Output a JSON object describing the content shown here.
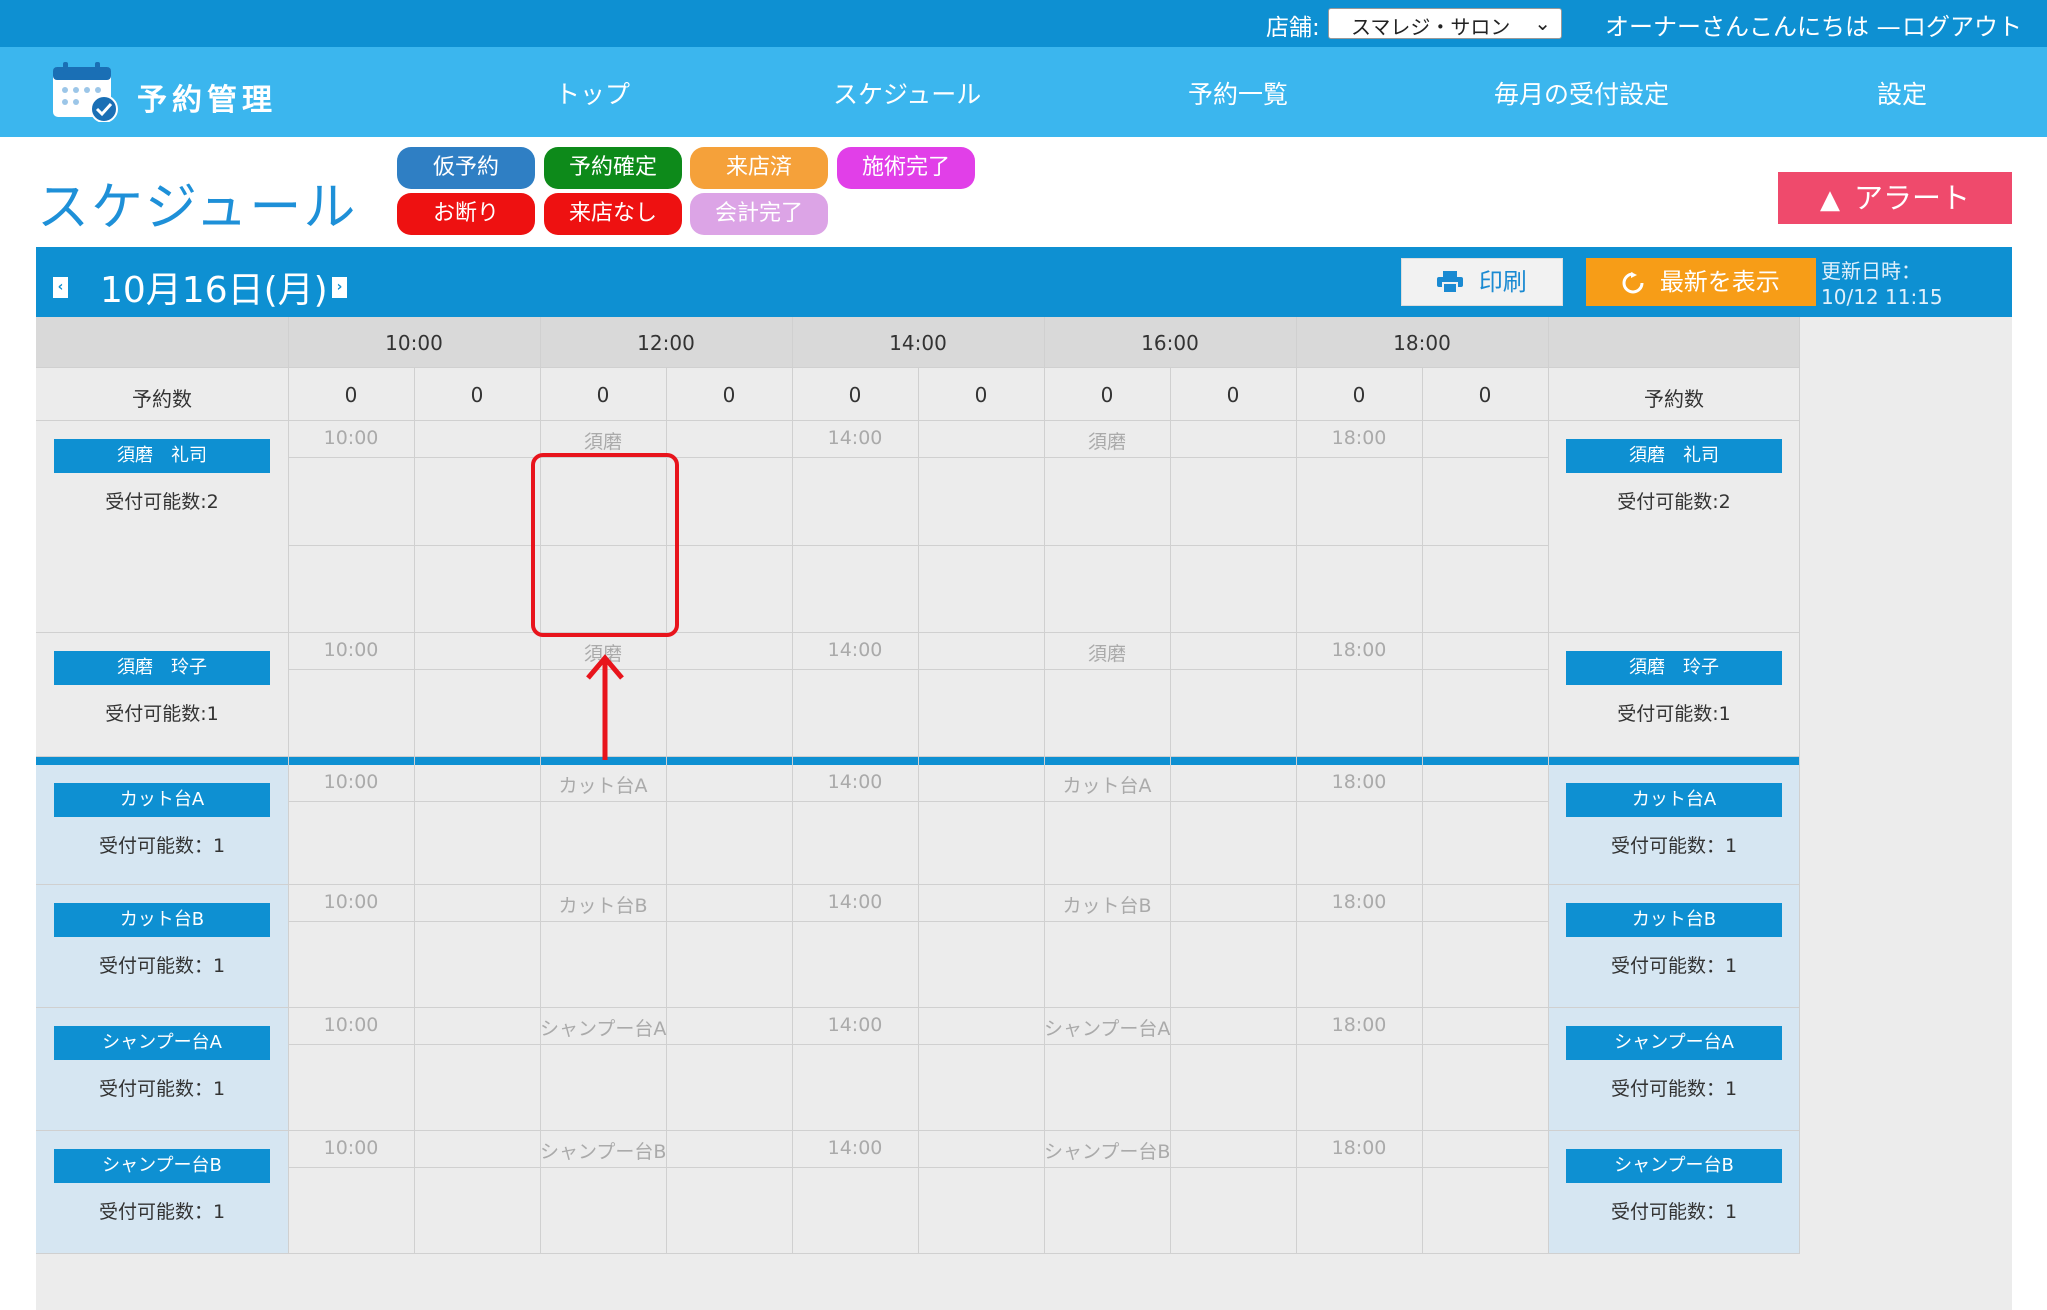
{
  "topbar": {
    "store_label": "店舗:",
    "store_value": "スマレジ・サロン",
    "greeting": "オーナーさんこんにちは —",
    "logout": "ログアウト"
  },
  "nav": {
    "brand": "予約管理",
    "items": [
      "トップ",
      "スケジュール",
      "予約一覧",
      "毎月の受付設定",
      "設定"
    ]
  },
  "page": {
    "title": "スケジュール",
    "alert": "アラート"
  },
  "legend": [
    {
      "label": "仮予約",
      "color": "#2f7fc4"
    },
    {
      "label": "予約確定",
      "color": "#0d8a1a"
    },
    {
      "label": "来店済",
      "color": "#f5a13a"
    },
    {
      "label": "施術完了",
      "color": "#e13fe8"
    },
    {
      "label": "お断り",
      "color": "#ee1111"
    },
    {
      "label": "来店なし",
      "color": "#ee1111"
    },
    {
      "label": "会計完了",
      "color": "#dca4e6"
    }
  ],
  "datebar": {
    "prev": "‹",
    "next": "›",
    "date": "10月16日(月)",
    "print": "印刷",
    "refresh": "最新を表示",
    "updated_label": "更新日時：",
    "updated_value": "10/12 11:15"
  },
  "schedule": {
    "hours": [
      "10:00",
      "12:00",
      "14:00",
      "16:00",
      "18:00"
    ],
    "count_label": "予約数",
    "counts": [
      "0",
      "0",
      "0",
      "0",
      "0",
      "0",
      "0",
      "0",
      "0",
      "0"
    ],
    "staff": [
      {
        "name": "須磨　礼司",
        "capacity": "受付可能数:2",
        "slots": [
          "10:00",
          "須磨",
          "14:00",
          "須磨",
          "18:00"
        ]
      },
      {
        "name": "須磨　玲子",
        "capacity": "受付可能数:1",
        "slots": [
          "10:00",
          "須磨",
          "14:00",
          "須磨",
          "18:00"
        ]
      }
    ],
    "equipment": [
      {
        "name": "カット台A",
        "capacity": "受付可能数：1",
        "slots": [
          "10:00",
          "カット台A",
          "14:00",
          "カット台A",
          "18:00"
        ]
      },
      {
        "name": "カット台B",
        "capacity": "受付可能数：1",
        "slots": [
          "10:00",
          "カット台B",
          "14:00",
          "カット台B",
          "18:00"
        ]
      },
      {
        "name": "シャンプー台A",
        "capacity": "受付可能数：1",
        "slots": [
          "10:00",
          "シャンプー台A",
          "14:00",
          "シャンプー台A",
          "18:00"
        ]
      },
      {
        "name": "シャンプー台B",
        "capacity": "受付可能数：1",
        "slots": [
          "10:00",
          "シャンプー台B",
          "14:00",
          "シャンプー台B",
          "18:00"
        ]
      }
    ]
  }
}
